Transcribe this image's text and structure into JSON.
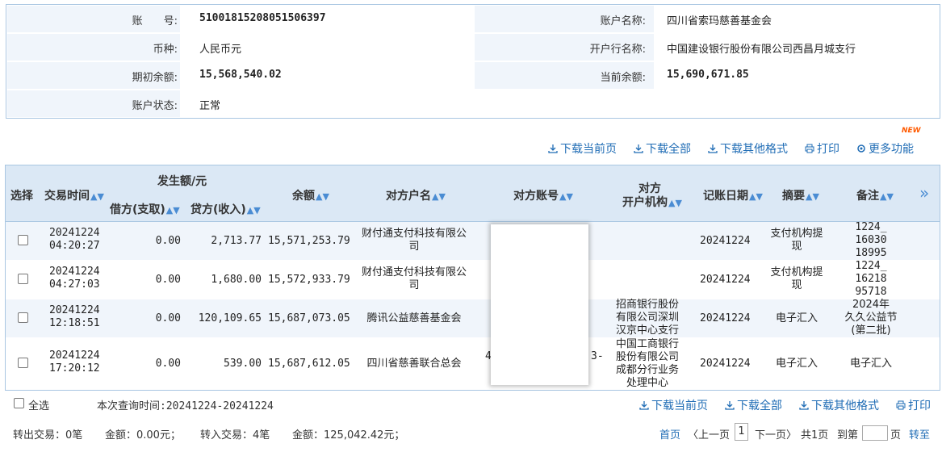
{
  "account": {
    "no_label": "账　　号:",
    "no_value": "51001815208051506397",
    "name_label": "账户名称:",
    "name_value": "四川省索玛慈善基金会",
    "currency_label": "币种:",
    "currency_value": "人民币元",
    "bank_label": "开户行名称:",
    "bank_value": "中国建设银行股份有限公司西昌月城支行",
    "opening_label": "期初余额:",
    "opening_value": "15,568,540.02",
    "current_label": "当前余额:",
    "current_value": "15,690,671.85",
    "status_label": "账户状态:",
    "status_value": "正常"
  },
  "toolbar": {
    "download_current": "下载当前页",
    "download_all": "下载全部",
    "download_other": "下载其他格式",
    "print": "打印",
    "more": "更多功能",
    "new_badge": "NEW"
  },
  "table": {
    "headers": {
      "select": "选择",
      "time": "交易时间",
      "amount_group": "发生额/元",
      "debit": "借方(支取)",
      "credit": "贷方(收入)",
      "balance": "余额",
      "counter_name": "对方户名",
      "counter_account": "对方账号",
      "counter_bank_1": "对方",
      "counter_bank_2": "开户机构",
      "post_date": "记账日期",
      "summary": "摘要",
      "remark": "备注",
      "more": "»"
    },
    "rows": [
      {
        "date": "20241224",
        "time": "04:20:27",
        "debit": "0.00",
        "credit": "2,713.77",
        "balance": "15,571,253.79",
        "name1": "财付通支付科技有限公",
        "name2": "司",
        "acct_pre": "",
        "acct_suf": "",
        "bank": [
          "",
          "",
          "",
          ""
        ],
        "post": "20241224",
        "sum1": "支付机构提",
        "sum2": "现",
        "rem": [
          "1224_",
          "16030",
          "18995"
        ]
      },
      {
        "date": "20241224",
        "time": "04:27:03",
        "debit": "0.00",
        "credit": "1,680.00",
        "balance": "15,572,933.79",
        "name1": "财付通支付科技有限公",
        "name2": "司",
        "acct_pre": "",
        "acct_suf": "",
        "bank": [
          "",
          "",
          "",
          ""
        ],
        "post": "20241224",
        "sum1": "支付机构提",
        "sum2": "现",
        "rem": [
          "1224_",
          "16218",
          "95718"
        ]
      },
      {
        "date": "20241224",
        "time": "12:18:51",
        "debit": "0.00",
        "credit": "120,109.65",
        "balance": "15,687,073.05",
        "name1": "腾讯公益慈善基金会",
        "name2": "",
        "acct_pre": "",
        "acct_suf": "",
        "bank": [
          "招商银行股份",
          "有限公司深圳",
          "汉京中心支行",
          ""
        ],
        "post": "20241224",
        "sum1": "电子汇入",
        "sum2": "",
        "rem": [
          "2024年",
          "久久公益节",
          "(第二批)"
        ]
      },
      {
        "date": "20241224",
        "time": "17:20:12",
        "debit": "0.00",
        "credit": "539.00",
        "balance": "15,687,612.05",
        "name1": "四川省慈善联合总会",
        "name2": "",
        "acct_pre": "4",
        "acct_suf": "3-",
        "bank": [
          "中国工商银行",
          "股份有限公司",
          "成都分行业务",
          "处理中心"
        ],
        "post": "20241224",
        "sum1": "电子汇入",
        "sum2": "",
        "rem": [
          "电子汇入",
          "",
          ""
        ]
      }
    ]
  },
  "footer": {
    "select_all": "全选",
    "query_time": "本次查询时间:20241224-20241224",
    "download_current": "下载当前页",
    "download_all": "下载全部",
    "download_other": "下载其他格式",
    "print": "打印",
    "out_count": "转出交易：0笔",
    "out_amount": "金额：0.00元；",
    "in_count": "转入交易：4笔",
    "in_amount": "金额：125,042.42元；",
    "first": "首页",
    "prev": "〈上一页",
    "page_no": "1",
    "next": "下一页〉",
    "total": "共1页",
    "goto_label": "到第",
    "goto_value": "",
    "page_unit": "页",
    "go": "转至"
  }
}
